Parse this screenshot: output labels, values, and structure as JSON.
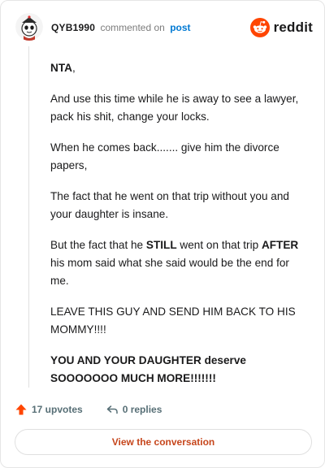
{
  "header": {
    "username": "QYB1990",
    "action_text": "commented on",
    "post_link": "post",
    "brand_name": "reddit",
    "avatar_icon": "user-avatar-icon"
  },
  "comment": {
    "p1_bold": "NTA",
    "p1_rest": ",",
    "p2": "And use this time while he is away to see a lawyer, pack his shit, change your locks.",
    "p3": "When he comes back....... give him the divorce papers,",
    "p4": "The fact that he went on that trip without you and your daughter is insane.",
    "p5_a": "But the fact that he ",
    "p5_b": "STILL",
    "p5_c": " went on that trip ",
    "p5_d": "AFTER",
    "p5_e": " his mom said what she said would be the end for me.",
    "p6": "LEAVE THIS GUY AND SEND HIM BACK TO HIS MOMMY!!!!",
    "p7": "YOU AND YOUR DAUGHTER deserve SOOOOOOO MUCH MORE!!!!!!!"
  },
  "footer": {
    "upvotes": "17 upvotes",
    "replies": "0 replies",
    "view_button": "View the conversation"
  },
  "colors": {
    "brand_orange": "#ff4500",
    "link_blue": "#0079d3",
    "button_text": "#c6461c",
    "muted": "#576f76"
  }
}
